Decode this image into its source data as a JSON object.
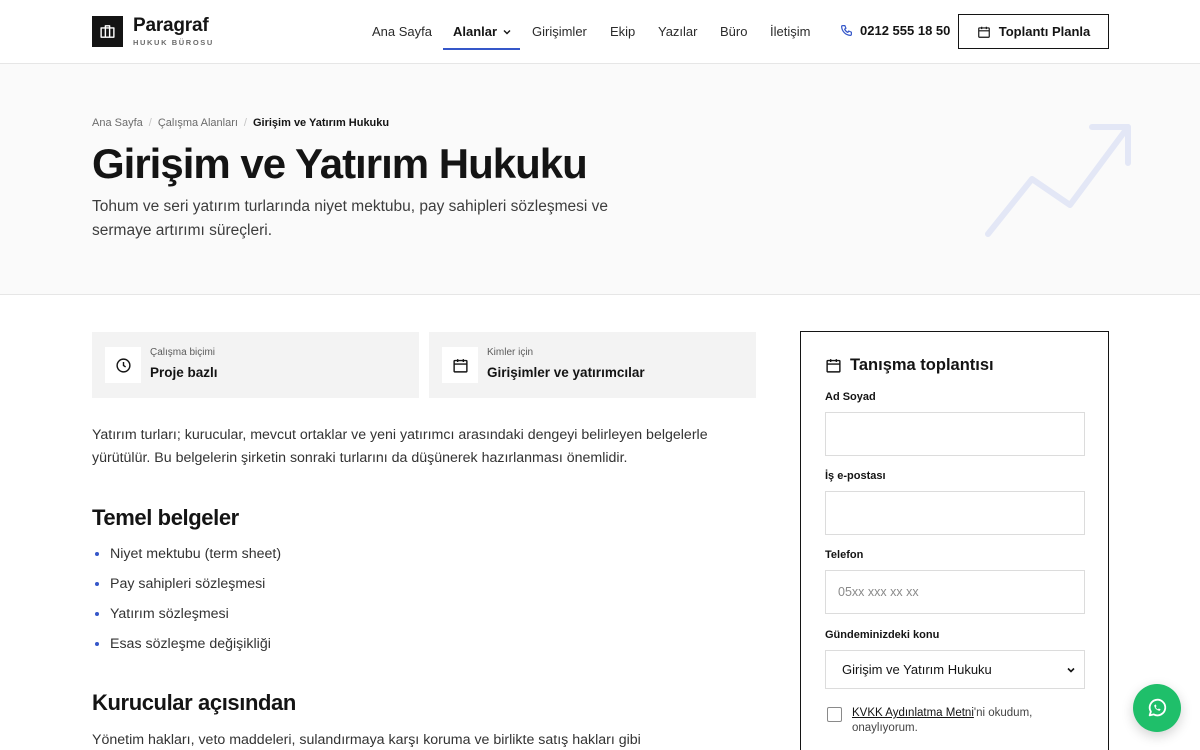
{
  "brand": {
    "name": "Paragraf",
    "subtitle": "HUKUK BÜROSU"
  },
  "nav": {
    "items": [
      {
        "label": "Ana Sayfa"
      },
      {
        "label": "Alanlar"
      },
      {
        "label": "Girişimler"
      },
      {
        "label": "Ekip"
      },
      {
        "label": "Yazılar"
      },
      {
        "label": "Büro"
      },
      {
        "label": "İletişim"
      }
    ],
    "active": "Alanlar",
    "phone": "0212 555 18 50",
    "cta": "Toplantı Planla"
  },
  "breadcrumb": {
    "home": "Ana Sayfa",
    "section": "Çalışma Alanları",
    "current": "Girişim ve Yatırım Hukuku"
  },
  "hero": {
    "title": "Girişim ve Yatırım Hukuku",
    "lead": "Tohum ve seri yatırım turlarında niyet mektubu, pay sahipleri sözleşmesi ve sermaye artırımı süreçleri."
  },
  "info": [
    {
      "label": "Çalışma biçimi",
      "value": "Proje bazlı",
      "icon": "clock-icon"
    },
    {
      "label": "Kimler için",
      "value": "Girişimler ve yatırımcılar",
      "icon": "calendar-icon"
    }
  ],
  "content": {
    "intro": "Yatırım turları; kurucular, mevcut ortaklar ve yeni yatırımcı arasındaki dengeyi belirleyen belgelerle yürütülür. Bu belgelerin şirketin sonraki turlarını da düşünerek hazırlanması önemlidir.",
    "section1_title": "Temel belgeler",
    "bullets": [
      "Niyet mektubu (term sheet)",
      "Pay sahipleri sözleşmesi",
      "Yatırım sözleşmesi",
      "Esas sözleşme değişikliği"
    ],
    "section2_title": "Kurucular açısından",
    "section2_text": "Yönetim hakları, veto maddeleri, sulandırmaya karşı koruma ve birlikte satış hakları gibi"
  },
  "form": {
    "title": "Tanışma toplantısı",
    "name_label": "Ad Soyad",
    "email_label": "İş e-postası",
    "phone_label": "Telefon",
    "phone_placeholder": "05xx xxx xx xx",
    "topic_label": "Gündeminizdeki konu",
    "topic_value": "Girişim ve Yatırım Hukuku",
    "consent_link": "KVKK Aydınlatma Metni",
    "consent_text": "'ni okudum, onaylıyorum."
  },
  "colors": {
    "accent": "#3557c9",
    "whatsapp": "#1fbf6a",
    "ink": "#141414"
  }
}
